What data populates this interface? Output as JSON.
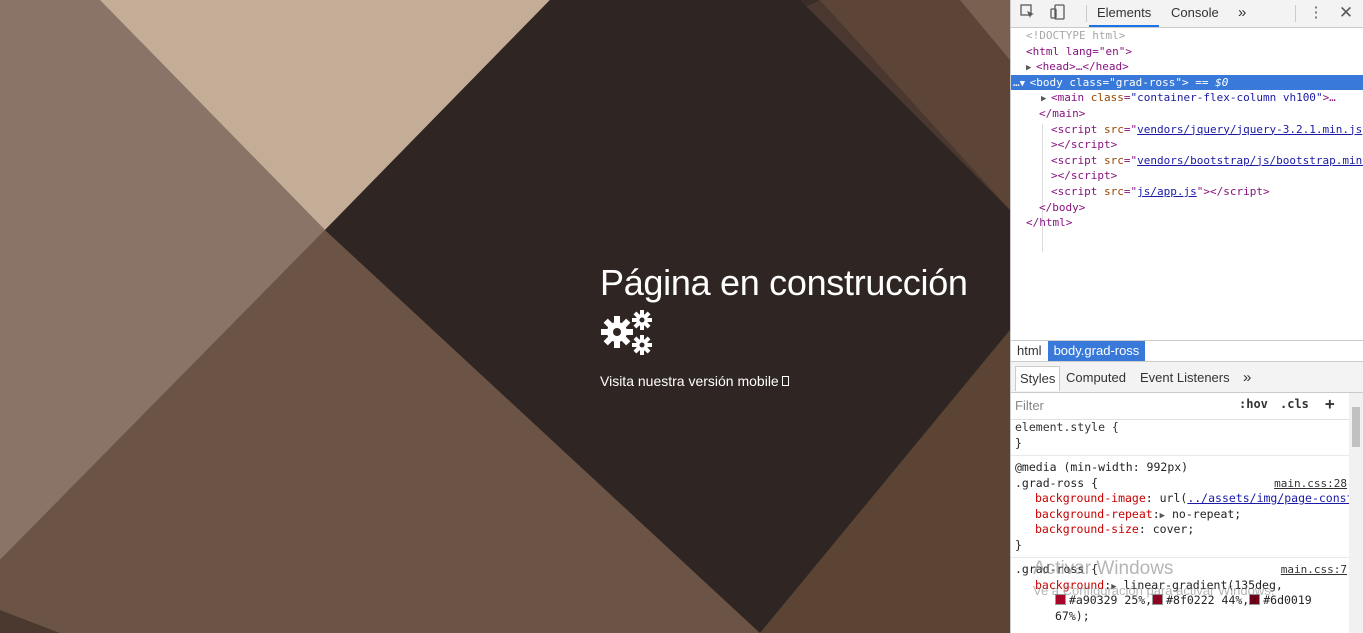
{
  "page": {
    "title": "Página en construcción",
    "mobile_link": "Visita nuestra versión mobile"
  },
  "devtools": {
    "tabs": [
      "Elements",
      "Console"
    ],
    "more_tabs": "»",
    "dom": {
      "doctype": "<!DOCTYPE html>",
      "html_open": "<html lang=\"en\">",
      "head": "<head>…</head>",
      "body_open_tag": "body",
      "body_class": "grad-ross",
      "body_suffix": " == $0",
      "main_class": "container-flex-column vh100",
      "main_close": "</main>",
      "scripts": [
        "vendors/jquery/jquery-3.2.1.min.js",
        "vendors/bootstrap/js/bootstrap.min.js",
        "js/app.js"
      ],
      "body_close": "</body>",
      "html_close": "</html>"
    },
    "breadcrumbs": [
      "html",
      "body.grad-ross"
    ],
    "styles_tabs": [
      "Styles",
      "Computed",
      "Event Listeners"
    ],
    "filter_placeholder": "Filter",
    "filter_hov": ":hov",
    "filter_cls": ".cls",
    "styles": {
      "element_style": "element.style {",
      "close": "}",
      "media": "@media (min-width: 992px)",
      "rule1_selector": ".grad-ross {",
      "rule1_source": "main.css:28",
      "bg_image_prop": "background-image",
      "bg_image_url": "../assets/img/page-construccion.jpg",
      "bg_repeat_prop": "background-repeat",
      "bg_repeat_val": "no-repeat;",
      "bg_size_prop": "background-size",
      "bg_size_val": "cover;",
      "rule2_selector": ".grad-ross {",
      "rule2_source": "main.css:7",
      "bg_prop": "background",
      "bg_val_start": "linear-gradient(135deg,",
      "color1": "#a90329",
      "color1_stop": "25%,",
      "color2": "#8f0222",
      "color2_stop": "44%,",
      "color3": "#6d0019",
      "color3_stop": "67%);"
    },
    "watermark_title": "Activar Windows",
    "watermark_sub": "Ve a Configuración para activar Windows."
  }
}
